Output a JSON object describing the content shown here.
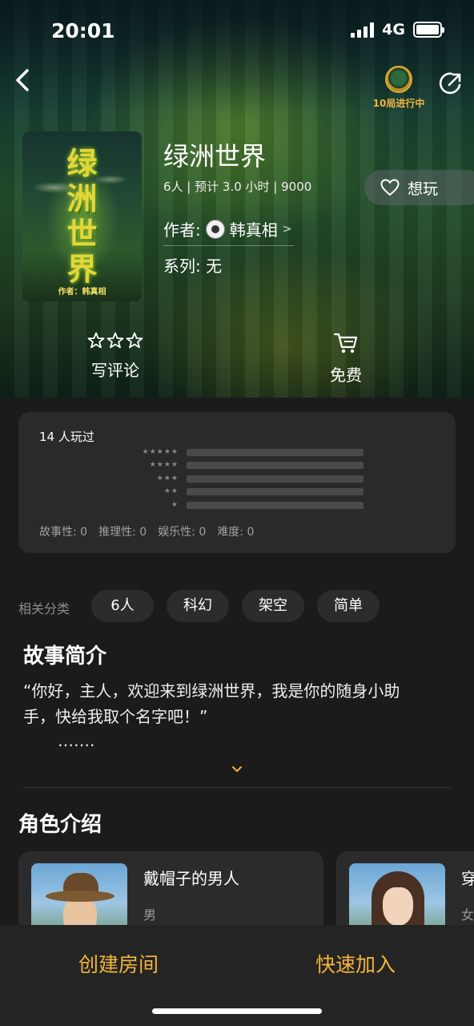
{
  "status_bar": {
    "time": "20:01",
    "network": "4G"
  },
  "header": {
    "room_badge_label": "10局进行中"
  },
  "game": {
    "title": "绿洲世界",
    "meta": "6人 | 预计 3.0 小时 | 9000",
    "cover_title_lines": [
      "绿",
      "洲",
      "世",
      "界"
    ],
    "cover_author": "作者：韩真相",
    "author_label": "作者:",
    "author_name": "韩真相",
    "author_arrow": ">",
    "series": "系列: 无",
    "want_label": "想玩"
  },
  "actions": {
    "review_label": "写评论",
    "price_label": "免费"
  },
  "ratings": {
    "plays": "14 人玩过",
    "star_rows": [
      "★★★★★",
      "★★★★",
      "★★★",
      "★★",
      "★"
    ],
    "scores": [
      {
        "label": "故事性:",
        "value": "0"
      },
      {
        "label": "推理性:",
        "value": "0"
      },
      {
        "label": "娱乐性:",
        "value": "0"
      },
      {
        "label": "难度:",
        "value": "0"
      }
    ]
  },
  "tags": {
    "label": "相关分类",
    "items": [
      "6人",
      "科幻",
      "架空",
      "简单"
    ]
  },
  "story": {
    "heading": "故事简介",
    "text": "“你好，主人，欢迎来到绿洲世界，我是你的随身小助手，快给我取个名字吧！”",
    "ellipsis": "……."
  },
  "characters": {
    "heading": "角色介绍",
    "items": [
      {
        "name": "戴帽子的男人",
        "gender": "男"
      },
      {
        "name": "穿",
        "gender": "女"
      }
    ]
  },
  "bottom": {
    "create_room": "创建房间",
    "quick_join": "快速加入"
  },
  "colors": {
    "accent": "#f2b53a",
    "background": "#1b1b1b",
    "card": "#2a2a2a"
  }
}
